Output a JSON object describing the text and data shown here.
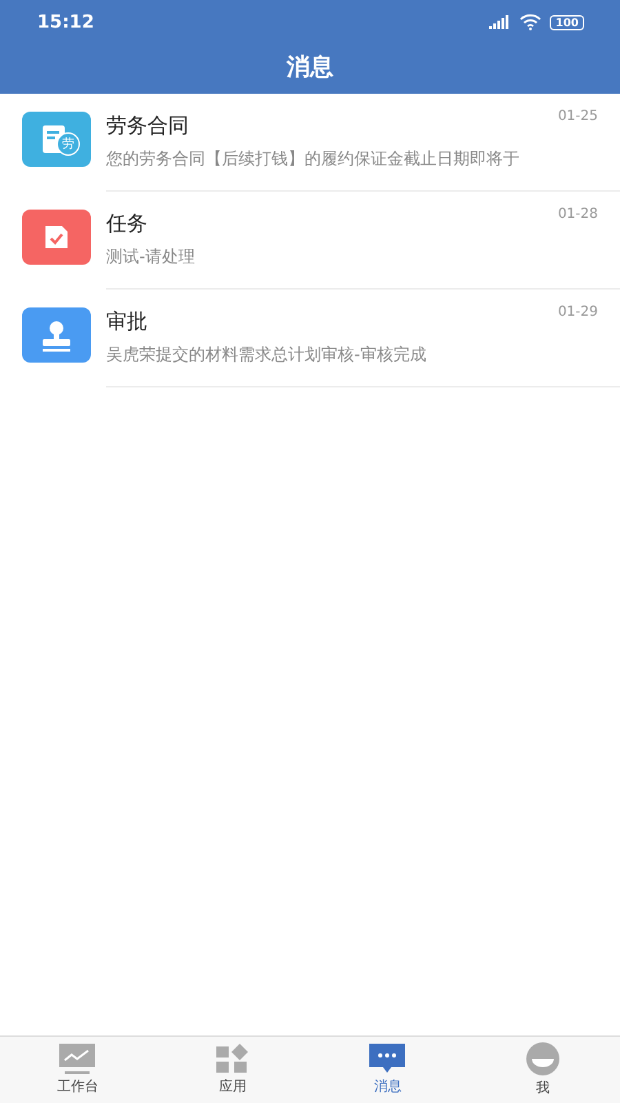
{
  "status_bar": {
    "time": "15:12",
    "battery": "100"
  },
  "header": {
    "title": "消息"
  },
  "messages": [
    {
      "kind": "contract",
      "color": "#3fb0e0",
      "icon_text": "劳",
      "title": "劳务合同",
      "date": "01-25",
      "preview": "您的劳务合同【后续打钱】的履约保证金截止日期即将于"
    },
    {
      "kind": "task",
      "color": "#f56563",
      "title": "任务",
      "date": "01-28",
      "preview": "测试-请处理"
    },
    {
      "kind": "approval",
      "color": "#4a9bf2",
      "title": "审批",
      "date": "01-29",
      "preview": "吴虎荣提交的材料需求总计划审核-审核完成"
    }
  ],
  "tabs": [
    {
      "kind": "workbench",
      "label": "工作台",
      "selected": false
    },
    {
      "kind": "apps",
      "label": "应用",
      "selected": false
    },
    {
      "kind": "messages",
      "label": "消息",
      "selected": true
    },
    {
      "kind": "me",
      "label": "我",
      "selected": false
    }
  ]
}
